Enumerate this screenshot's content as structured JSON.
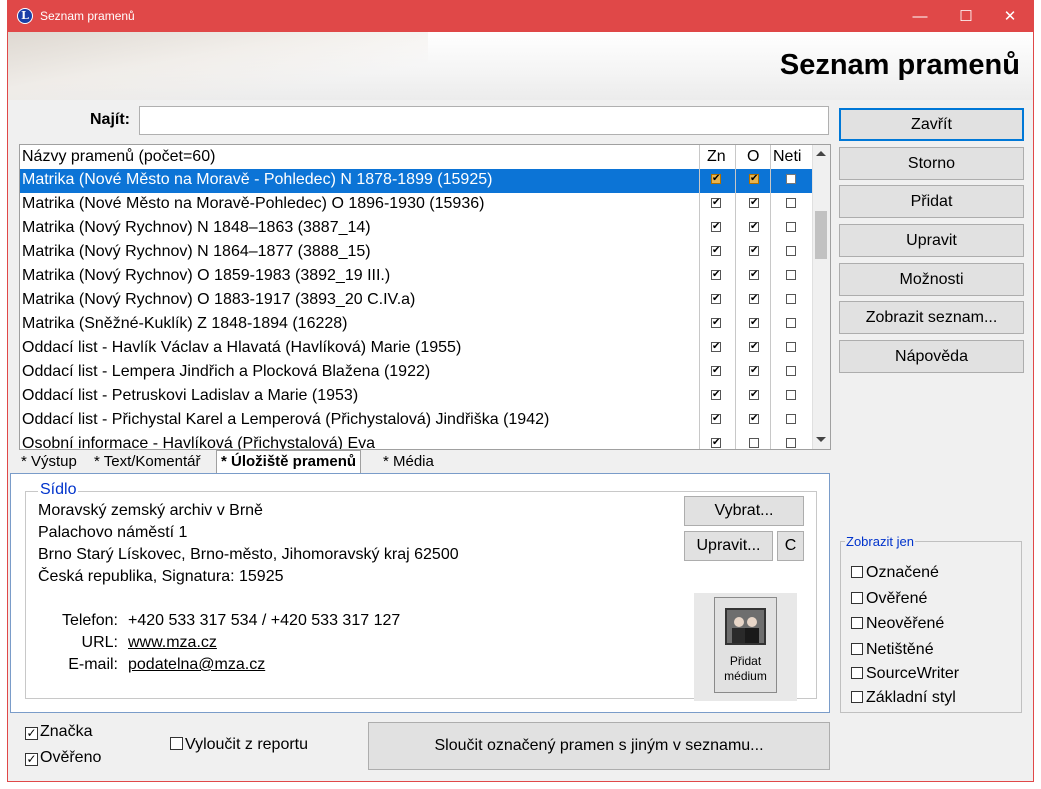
{
  "window": {
    "title": "Seznam pramenů",
    "app_icon_letter": "L"
  },
  "header": {
    "title": "Seznam pramenů"
  },
  "find": {
    "label": "Najít:",
    "value": ""
  },
  "list": {
    "header": {
      "name": "Názvy pramenů (počet=60)",
      "zn": "Zn",
      "o": "O",
      "neti": "Neti"
    },
    "rows": [
      {
        "name": "Matrika (Nové Město na Moravě - Pohledec) N 1878-1899 (15925)",
        "zn": true,
        "o": true,
        "neti": false,
        "selected": true
      },
      {
        "name": "Matrika (Nové Město na Moravě-Pohledec) O 1896-1930 (15936)",
        "zn": true,
        "o": true,
        "neti": false
      },
      {
        "name": "Matrika (Nový Rychnov) N 1848–1863 (3887_14)",
        "zn": true,
        "o": true,
        "neti": false
      },
      {
        "name": "Matrika (Nový Rychnov) N 1864–1877 (3888_15)",
        "zn": true,
        "o": true,
        "neti": false
      },
      {
        "name": "Matrika (Nový Rychnov) O 1859-1983 (3892_19 III.)",
        "zn": true,
        "o": true,
        "neti": false
      },
      {
        "name": "Matrika (Nový Rychnov) O 1883-1917 (3893_20 C.IV.a)",
        "zn": true,
        "o": true,
        "neti": false
      },
      {
        "name": "Matrika (Sněžné-Kuklík) Z 1848-1894 (16228)",
        "zn": true,
        "o": true,
        "neti": false
      },
      {
        "name": "Oddací list - Havlík Václav a Hlavatá (Havlíková) Marie (1955)",
        "zn": true,
        "o": true,
        "neti": false
      },
      {
        "name": "Oddací list - Lempera Jindřich a Plocková Blažena (1922)",
        "zn": true,
        "o": true,
        "neti": false
      },
      {
        "name": "Oddací list - Petruskovi Ladislav a Marie (1953)",
        "zn": true,
        "o": true,
        "neti": false
      },
      {
        "name": "Oddací list - Přichystal Karel a Lemperová (Přichystalová) Jindřiška (1942)",
        "zn": true,
        "o": true,
        "neti": false
      },
      {
        "name": "Osobní informace - Havlíková (Přichystalová) Eva",
        "zn": true,
        "o": false,
        "neti": false
      }
    ]
  },
  "tabs": [
    {
      "label": "* Výstup",
      "active": false
    },
    {
      "label": "* Text/Komentář",
      "active": false
    },
    {
      "label": "* Úložiště pramenů",
      "active": true
    },
    {
      "label": "* Média",
      "active": false
    }
  ],
  "repository": {
    "legend": "Sídlo",
    "address_lines": [
      "Moravský zemský archiv v Brně",
      "Palachovo náměstí 1",
      "Brno Starý Lískovec, Brno-město, Jihomoravský kraj  62500",
      "Česká republika, Signatura: 15925"
    ],
    "phone_label": "Telefon:",
    "phone_value": "+420 533 317 534  /  +420 533 317 127",
    "url_label": "URL:",
    "url_value": "www.mza.cz",
    "email_label": "E-mail:",
    "email_value": "podatelna@mza.cz",
    "choose_button": "Vybrat...",
    "edit_button": "Upravit...",
    "c_button": "C",
    "add_media_button": "Přidat médium"
  },
  "right_buttons": {
    "close": "Zavřít",
    "cancel": "Storno",
    "add": "Přidat",
    "edit": "Upravit",
    "options": "Možnosti",
    "show_list": "Zobrazit seznam...",
    "help": "Nápověda"
  },
  "show_only": {
    "legend": "Zobrazit jen",
    "items": [
      "Označené",
      "Ověřené",
      "Neověřené",
      "Netištěné",
      "SourceWriter",
      "Základní styl"
    ]
  },
  "bottom": {
    "mark_label": "Značka",
    "mark_checked": true,
    "verified_label": "Ověřeno",
    "verified_checked": true,
    "exclude_label": "Vyloučit z reportu",
    "exclude_checked": false,
    "merge_button": "Sloučit označený pramen s jiným v seznamu..."
  },
  "colors": {
    "titlebar": "#e04848",
    "selection": "#0c74d6",
    "legend_text": "#0033cc"
  }
}
